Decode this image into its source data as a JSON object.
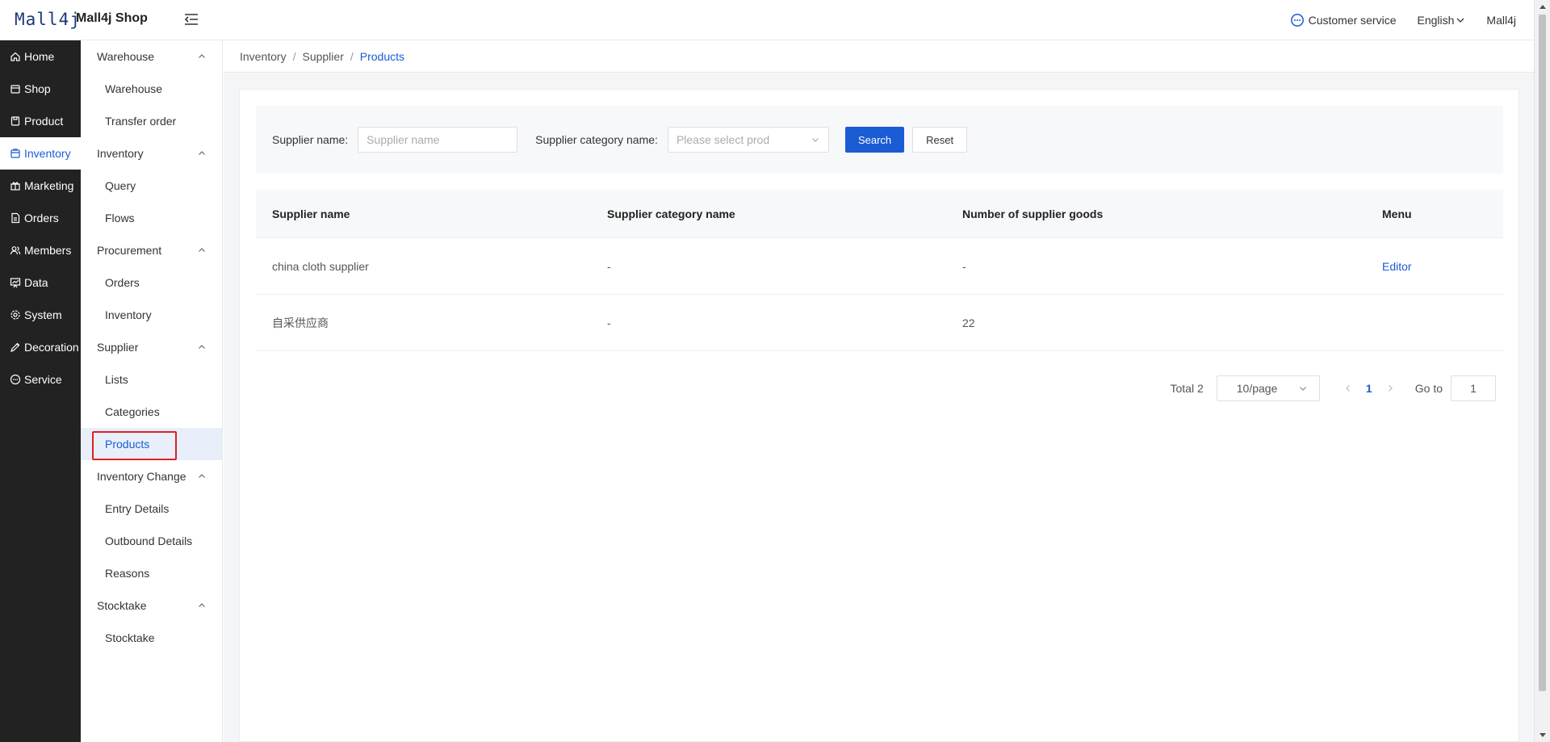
{
  "header": {
    "logo": "Mall4j",
    "shop_name": "Mall4j Shop",
    "customer_service": "Customer service",
    "language": "English",
    "user": "Mall4j"
  },
  "main_nav": [
    {
      "label": "Home",
      "icon": "home-icon"
    },
    {
      "label": "Shop",
      "icon": "shop-icon"
    },
    {
      "label": "Product",
      "icon": "product-icon"
    },
    {
      "label": "Inventory",
      "icon": "inventory-icon",
      "active": true
    },
    {
      "label": "Marketing",
      "icon": "gift-icon"
    },
    {
      "label": "Orders",
      "icon": "document-icon"
    },
    {
      "label": "Members",
      "icon": "members-icon"
    },
    {
      "label": "Data",
      "icon": "chart-icon"
    },
    {
      "label": "System",
      "icon": "gear-icon"
    },
    {
      "label": "Decoration",
      "icon": "brush-icon"
    },
    {
      "label": "Service",
      "icon": "chat-icon"
    }
  ],
  "sub_nav": {
    "groups": [
      {
        "label": "Warehouse",
        "items": [
          "Warehouse",
          "Transfer order"
        ]
      },
      {
        "label": "Inventory",
        "items": [
          "Query",
          "Flows"
        ]
      },
      {
        "label": "Procurement",
        "items": [
          "Orders",
          "Inventory"
        ]
      },
      {
        "label": "Supplier",
        "items": [
          "Lists",
          "Categories",
          "Products"
        ]
      },
      {
        "label": "Inventory Change",
        "items": [
          "Entry Details",
          "Outbound Details",
          "Reasons"
        ]
      },
      {
        "label": "Stocktake",
        "items": [
          "Stocktake"
        ]
      }
    ],
    "active_item": "Products"
  },
  "breadcrumb": [
    "Inventory",
    "Supplier",
    "Products"
  ],
  "filter": {
    "supplier_name_label": "Supplier name:",
    "supplier_name_placeholder": "Supplier name",
    "category_label": "Supplier category name:",
    "category_placeholder": "Please select prod",
    "search": "Search",
    "reset": "Reset"
  },
  "table": {
    "headers": [
      "Supplier name",
      "Supplier category name",
      "Number of supplier goods",
      "Menu"
    ],
    "rows": [
      [
        "china cloth supplier",
        "-",
        "-",
        "Editor"
      ],
      [
        "自采供应商",
        "-",
        "22",
        ""
      ]
    ]
  },
  "pagination": {
    "total": "Total 2",
    "page_size": "10/page",
    "current": "1",
    "goto_label": "Go to",
    "goto_value": "1"
  },
  "colors": {
    "accent": "#1a5cd3",
    "sidebar_bg": "#222222",
    "highlight": "#e02020"
  }
}
